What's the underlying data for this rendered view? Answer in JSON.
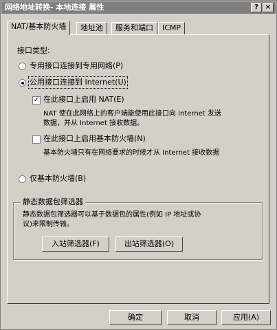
{
  "window": {
    "title": "网络地址转换- 本地连接 属性",
    "help_label": "?",
    "close_label": "×"
  },
  "tabs": [
    {
      "label": "NAT/基本防火墙"
    },
    {
      "label": "地址池"
    },
    {
      "label": "服务和端口"
    },
    {
      "label": "ICMP"
    }
  ],
  "interface": {
    "section_label": "接口类型:",
    "private_label": "专用接口连接到专用网络(P)",
    "public_label": "公用接口连接到 Internet(U)",
    "nat_check_label": "在此接口上启用 NAT(E)",
    "nat_desc_line1": "NAT 使在此网络上的客户端能使用此接口向 Internet 发送",
    "nat_desc_line2": "数据，并从 Internet 接收数据。",
    "fw_check_label": "在此接口上启用基本防火墙(N)",
    "fw_desc": "基本防火墙只有在网络要求的时候才从 Internet 接收数据",
    "basic_fw_only_label": "仅基本防火墙(B)"
  },
  "filters": {
    "group_title": "静态数据包筛选器",
    "desc_line1": "静态数据包筛选器可以基于数据包的属性(例如 IP 地址或协",
    "desc_line2": "议)来限制传输。",
    "inbound_button": "入站筛选器(F)",
    "outbound_button": "出站筛选器(O)"
  },
  "footer": {
    "ok_button": "确定",
    "cancel_button": "取消",
    "apply_button": "应用(A)"
  },
  "state": {
    "selected_interface": "public",
    "nat_enabled": true,
    "firewall_enabled": false
  }
}
